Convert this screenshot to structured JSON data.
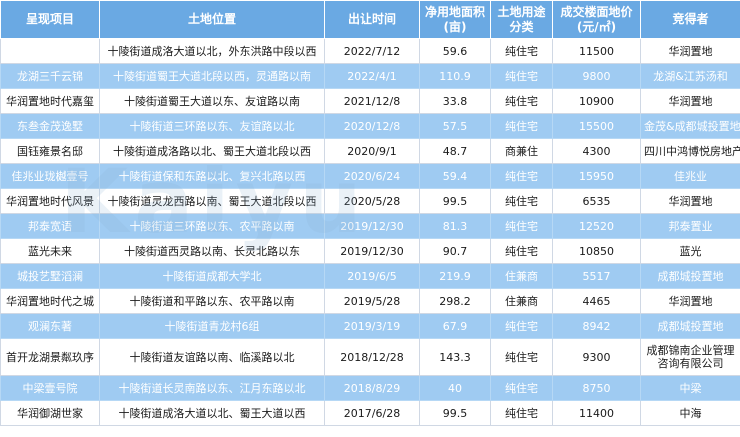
{
  "table": {
    "headers": [
      "呈现项目",
      "土地位置",
      "出让时间",
      "净用地面积\n(亩)",
      "土地用途\n分类",
      "成交楼面地价\n(元/㎡)",
      "竞得者"
    ],
    "rows": [
      {
        "style": "white",
        "cells": [
          "",
          "十陵街道成洛大道以北，外东洪路中段以西",
          "2022/7/12",
          "59.6",
          "纯住宅",
          "11500",
          "华润置地"
        ]
      },
      {
        "style": "blue",
        "cells": [
          "龙湖三千云锦",
          "十陵街道蜀王大道北段以西，灵通路以南",
          "2022/4/1",
          "110.9",
          "纯住宅",
          "9800",
          "龙湖&江苏汤和"
        ]
      },
      {
        "style": "white",
        "cells": [
          "华润置地时代嘉玺",
          "十陵街道蜀王大道以东、友谊路以南",
          "2021/12/8",
          "33.8",
          "纯住宅",
          "10900",
          "华润置地"
        ]
      },
      {
        "style": "blue",
        "cells": [
          "东叁金茂逸墅",
          "十陵街道三环路以东、友谊路以北",
          "2020/12/8",
          "57.5",
          "纯住宅",
          "15500",
          "金茂&成都城投置地"
        ]
      },
      {
        "style": "white",
        "cells": [
          "国钰雍景名邸",
          "十陵街道成洛路以北、蜀王大道北段以西",
          "2020/9/1",
          "48.7",
          "商兼住",
          "4300",
          "四川中鸿博悦房地产"
        ]
      },
      {
        "style": "blue",
        "cells": [
          "佳兆业珑樾壹号",
          "十陵街道保和东路以北、复兴北路以西",
          "2020/6/24",
          "59.4",
          "纯住宅",
          "15950",
          "佳兆业"
        ]
      },
      {
        "style": "white",
        "cells": [
          "华润置地时代风景",
          "十陵街道灵龙西路以南、蜀王大道北段以西",
          "2020/5/28",
          "99.5",
          "纯住宅",
          "6535",
          "华润置地"
        ]
      },
      {
        "style": "blue",
        "cells": [
          "邦泰宽语",
          "十陵街道三环路以东、农平路以南",
          "2019/12/30",
          "81.3",
          "纯住宅",
          "12520",
          "邦泰置业"
        ]
      },
      {
        "style": "white",
        "cells": [
          "蓝光未来",
          "十陵街道西灵路以南、长灵北路以东",
          "2019/12/30",
          "90.7",
          "纯住宅",
          "10850",
          "蓝光"
        ]
      },
      {
        "style": "blue",
        "cells": [
          "城投艺墅滔澜",
          "十陵街道成都大学北",
          "2019/6/5",
          "219.9",
          "住兼商",
          "5517",
          "成都城投置地"
        ]
      },
      {
        "style": "white",
        "cells": [
          "华润置地时代之城",
          "十陵街道和平路以东、农平路以南",
          "2019/5/28",
          "298.2",
          "住兼商",
          "4465",
          "华润置地"
        ]
      },
      {
        "style": "blue",
        "cells": [
          "观澜东著",
          "十陵街道青龙村6组",
          "2019/3/19",
          "67.9",
          "纯住宅",
          "8942",
          "成都城投置地"
        ]
      },
      {
        "style": "white",
        "tall": true,
        "cells": [
          "首开龙湖景粼玖序",
          "十陵街道友谊路以南、临溪路以北",
          "2018/12/28",
          "143.3",
          "纯住宅",
          "9300",
          "成都锦南企业管理咨询有限公司"
        ]
      },
      {
        "style": "blue",
        "cells": [
          "中梁壹号院",
          "十陵街道长灵南路以东、江月东路以北",
          "2018/8/29",
          "40",
          "纯住宅",
          "8750",
          "中梁"
        ]
      },
      {
        "style": "white",
        "cells": [
          "华润御湖世家",
          "十陵街道成洛大道以北、蜀王大道以西",
          "2017/6/28",
          "99.5",
          "纯住宅",
          "11400",
          "中海"
        ]
      }
    ]
  },
  "watermark": "Kaiyu"
}
